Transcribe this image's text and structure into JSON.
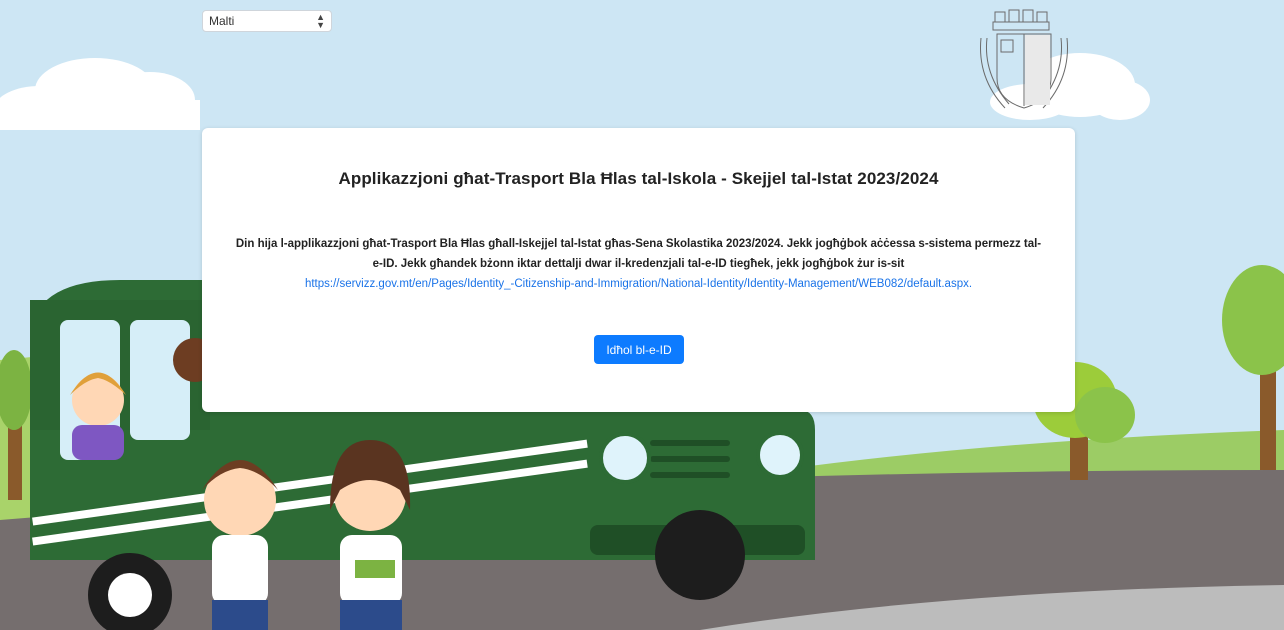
{
  "language_select": {
    "value": "Malti"
  },
  "card": {
    "title": "Applikazzjoni għat-Trasport Bla Ħlas tal-Iskola - Skejjel tal-Istat 2023/2024",
    "body": "Din hija l-applikazzjoni għat-Trasport Bla Ħlas għall-Iskejjel tal-Istat għas-Sena Skolastika 2023/2024. Jekk jogħġbok aċċessa s-sistema permezz tal-e-ID. Jekk għandek bżonn iktar dettalji dwar il-kredenzjali tal-e-ID tiegħek, jekk jogħġbok żur is-sit",
    "link": "https://servizz.gov.mt/en/Pages/Identity_-Citizenship-and-Immigration/National-Identity/Identity-Management/WEB082/default.aspx.",
    "button_label": "Idħol bl-e-ID"
  },
  "colors": {
    "sky": "#c9e4f3",
    "bus": "#2d6b35",
    "grass": "#9ccc65",
    "road": "#757070",
    "button": "#0d7bff",
    "link": "#1a73e8"
  },
  "icons": [
    "coat-of-arms-icon",
    "sort-caret-icon"
  ]
}
